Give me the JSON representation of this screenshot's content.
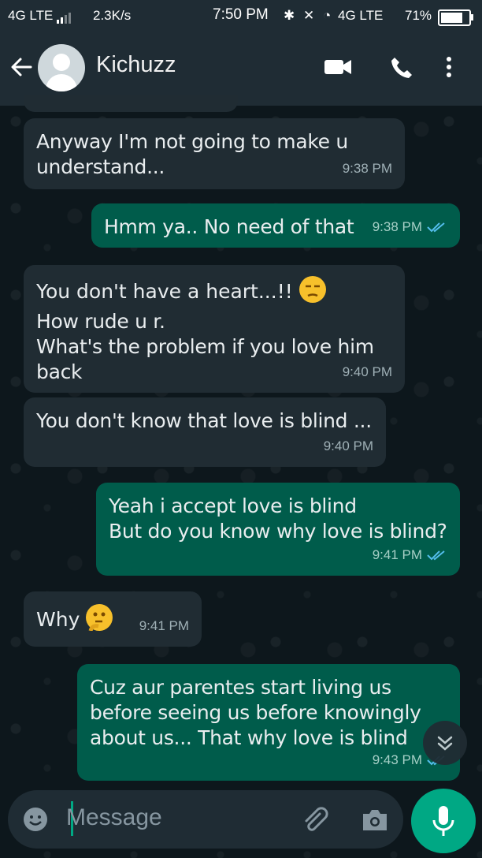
{
  "status_bar": {
    "network_left": "4G LTE",
    "speed": "2.3K/s",
    "time": "7:50 PM",
    "network_right": "4G LTE",
    "battery": "71%"
  },
  "header": {
    "contact_name": "Kichuzz",
    "icons": [
      "back-arrow-icon",
      "avatar",
      "video-call-icon",
      "voice-call-icon",
      "more-options-icon"
    ]
  },
  "messages": [
    {
      "direction": "in",
      "text": "Anyway I'm not going to make u\nunderstand...",
      "time": "9:38 PM"
    },
    {
      "direction": "out",
      "text": "Hmm ya.. No need of that",
      "time": "9:38 PM",
      "read": true
    },
    {
      "direction": "in",
      "text": "You don't have a heart...!! ",
      "emoji": "unamused-face",
      "text2": "How rude u r.\nWhat's the problem if you love him\nback",
      "time": "9:40 PM"
    },
    {
      "direction": "in",
      "text": "You don't know that love is blind  ...",
      "time": "9:40 PM"
    },
    {
      "direction": "out",
      "text": "Yeah i accept love is blind\nBut do you know why love is blind?",
      "time": "9:41 PM",
      "read": true
    },
    {
      "direction": "in",
      "text": "Why ",
      "emoji": "thinking-face",
      "time": "9:41 PM"
    },
    {
      "direction": "out",
      "text": "Cuz aur parentes start living us\nbefore seeing us before knowingly\nabout us... That why love is blind",
      "time": "9:43 PM",
      "read": true
    }
  ],
  "composer": {
    "placeholder": "Message",
    "icons": [
      "emoji-icon",
      "attach-icon",
      "camera-icon",
      "mic-icon"
    ]
  },
  "colors": {
    "incoming_bubble": "#202c33",
    "outgoing_bubble": "#005c4b",
    "accent": "#00a884",
    "header": "#1f2c34"
  }
}
